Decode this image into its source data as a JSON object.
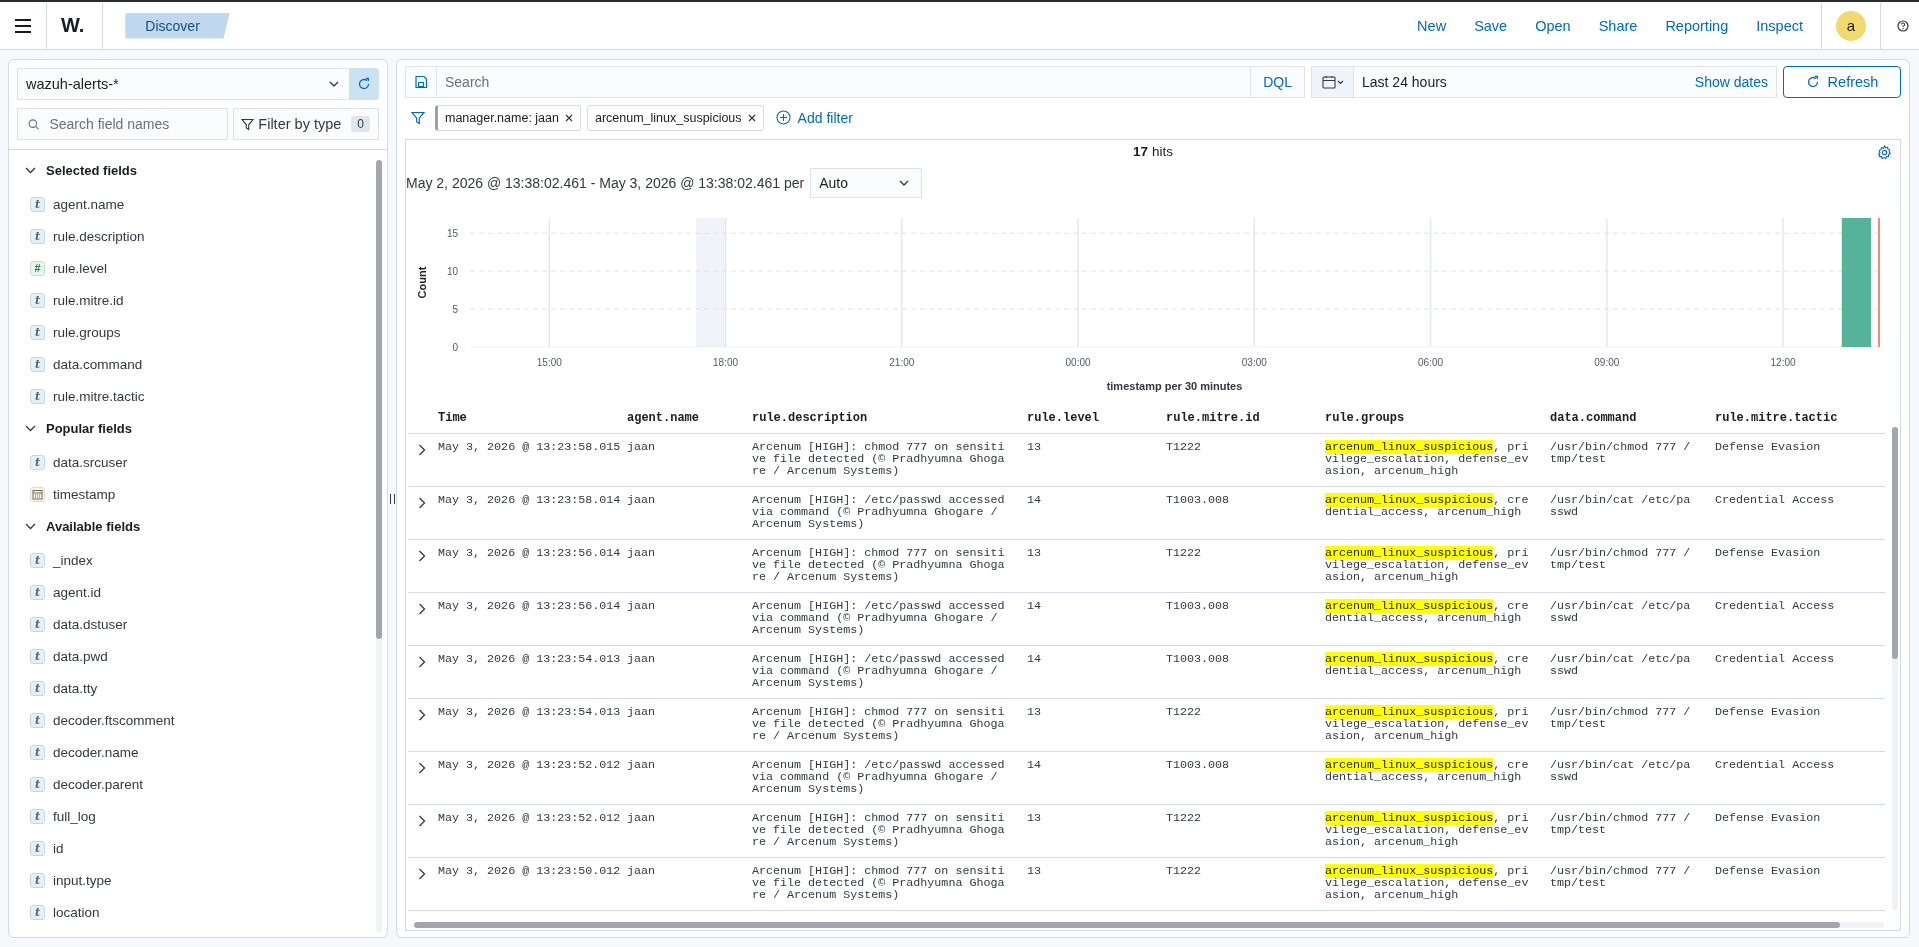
{
  "header": {
    "logo": "W.",
    "breadcrumb": "Discover",
    "actions": [
      "New",
      "Save",
      "Open",
      "Share",
      "Reporting",
      "Inspect"
    ],
    "avatar": "a"
  },
  "sidebar": {
    "index_pattern": "wazuh-alerts-*",
    "search": {
      "placeholder": "Search field names"
    },
    "filter_button": "Filter by type",
    "filter_count": "0",
    "sections": [
      {
        "title": "Selected fields",
        "expanded": true,
        "fields": [
          {
            "name": "agent.name",
            "kind": "string",
            "token": "t"
          },
          {
            "name": "rule.description",
            "kind": "string",
            "token": "t"
          },
          {
            "name": "rule.level",
            "kind": "number",
            "token": "#"
          },
          {
            "name": "rule.mitre.id",
            "kind": "string",
            "token": "t"
          },
          {
            "name": "rule.groups",
            "kind": "string",
            "token": "t"
          },
          {
            "name": "data.command",
            "kind": "string",
            "token": "t"
          },
          {
            "name": "rule.mitre.tactic",
            "kind": "string",
            "token": "t"
          }
        ]
      },
      {
        "title": "Popular fields",
        "expanded": true,
        "fields": [
          {
            "name": "data.srcuser",
            "kind": "string",
            "token": "t"
          },
          {
            "name": "timestamp",
            "kind": "date"
          }
        ]
      },
      {
        "title": "Available fields",
        "expanded": true,
        "fields": [
          {
            "name": "_index",
            "kind": "string",
            "token": "t"
          },
          {
            "name": "agent.id",
            "kind": "string",
            "token": "t"
          },
          {
            "name": "data.dstuser",
            "kind": "string",
            "token": "t"
          },
          {
            "name": "data.pwd",
            "kind": "string",
            "token": "t"
          },
          {
            "name": "data.tty",
            "kind": "string",
            "token": "t"
          },
          {
            "name": "decoder.ftscomment",
            "kind": "string",
            "token": "t"
          },
          {
            "name": "decoder.name",
            "kind": "string",
            "token": "t"
          },
          {
            "name": "decoder.parent",
            "kind": "string",
            "token": "t"
          },
          {
            "name": "full_log",
            "kind": "string",
            "token": "t"
          },
          {
            "name": "id",
            "kind": "string",
            "token": "t"
          },
          {
            "name": "input.type",
            "kind": "string",
            "token": "t"
          },
          {
            "name": "location",
            "kind": "string",
            "token": "t"
          }
        ]
      }
    ]
  },
  "query": {
    "search": {
      "placeholder": "Search"
    },
    "language": "DQL",
    "time_range": "Last 24 hours",
    "show_dates": "Show dates",
    "refresh": "Refresh"
  },
  "filters": [
    {
      "label": "manager.name: jaan"
    },
    {
      "label": "arcenum_linux_suspicious"
    }
  ],
  "add_filter": "Add filter",
  "results": {
    "hits_count": "17",
    "hits_label": "hits",
    "range": "May 2, 2026 @ 13:38:02.461 - May 3, 2026 @ 13:38:02.461 per",
    "interval": "Auto",
    "chart_data": {
      "type": "bar",
      "xlabel": "timestamp per 30 minutes",
      "ylabel": "Count",
      "x": [
        "2026-05-03T13:15:00"
      ],
      "values": [
        17
      ],
      "xlim": [
        "2026-05-02T13:39:00",
        "2026-05-03T13:38:00"
      ],
      "ylim": [
        0,
        17
      ],
      "grid": true,
      "bands": [
        {
          "axis": "x",
          "from": "2026-05-02T17:30:00",
          "to": "2026-05-02T18:00:00"
        }
      ],
      "xticks": [
        {
          "value": "2026-05-02T15:00:00",
          "label": "15:00"
        },
        {
          "value": "2026-05-02T18:00:00",
          "label": "18:00"
        },
        {
          "value": "2026-05-02T21:00:00",
          "label": "21:00"
        },
        {
          "value": "2026-05-03T00:00:00",
          "label": "00:00"
        },
        {
          "value": "2026-05-03T03:00:00",
          "label": "03:00"
        },
        {
          "value": "2026-05-03T06:00:00",
          "label": "06:00"
        },
        {
          "value": "2026-05-03T09:00:00",
          "label": "09:00"
        },
        {
          "value": "2026-05-03T12:00:00",
          "label": "12:00"
        }
      ],
      "yticks": [
        0,
        5,
        10,
        15
      ]
    }
  },
  "table": {
    "columns": [
      "Time",
      "agent.name",
      "rule.description",
      "rule.level",
      "rule.mitre.id",
      "rule.groups",
      "data.command",
      "rule.mitre.tactic"
    ],
    "rows": [
      {
        "expanded": false,
        "time": "May 3, 2026 @ 13:23:58.015",
        "agent": "jaan",
        "description": "Arcenum [HIGH]: chmod 777 on sensitive file detected (© Pradhyumna Ghogare / Arcenum Systems)",
        "level": "13",
        "mitre_id": "T1222",
        "groups_match": "arcenum_linux_suspicious",
        "groups_rest": ", privilege_escalation, defense_evasion, arcenum_high",
        "command": "/usr/bin/chmod 777 /tmp/test",
        "tactic": "Defense Evasion"
      },
      {
        "expanded": false,
        "time": "May 3, 2026 @ 13:23:58.014",
        "agent": "jaan",
        "description": "Arcenum [HIGH]: /etc/passwd accessed via command (© Pradhyumna Ghogare / Arcenum Systems)",
        "level": "14",
        "mitre_id": "T1003.008",
        "groups_match": "arcenum_linux_suspicious",
        "groups_rest": ", credential_access, arcenum_high",
        "command": "/usr/bin/cat /etc/passwd",
        "tactic": "Credential Access"
      },
      {
        "expanded": false,
        "time": "May 3, 2026 @ 13:23:56.014",
        "agent": "jaan",
        "description": "Arcenum [HIGH]: chmod 777 on sensitive file detected (© Pradhyumna Ghogare / Arcenum Systems)",
        "level": "13",
        "mitre_id": "T1222",
        "groups_match": "arcenum_linux_suspicious",
        "groups_rest": ", privilege_escalation, defense_evasion, arcenum_high",
        "command": "/usr/bin/chmod 777 /tmp/test",
        "tactic": "Defense Evasion"
      },
      {
        "expanded": false,
        "time": "May 3, 2026 @ 13:23:56.014",
        "agent": "jaan",
        "description": "Arcenum [HIGH]: /etc/passwd accessed via command (© Pradhyumna Ghogare / Arcenum Systems)",
        "level": "14",
        "mitre_id": "T1003.008",
        "groups_match": "arcenum_linux_suspicious",
        "groups_rest": ", credential_access, arcenum_high",
        "command": "/usr/bin/cat /etc/passwd",
        "tactic": "Credential Access"
      },
      {
        "expanded": false,
        "time": "May 3, 2026 @ 13:23:54.013",
        "agent": "jaan",
        "description": "Arcenum [HIGH]: /etc/passwd accessed via command (© Pradhyumna Ghogare / Arcenum Systems)",
        "level": "14",
        "mitre_id": "T1003.008",
        "groups_match": "arcenum_linux_suspicious",
        "groups_rest": ", credential_access, arcenum_high",
        "command": "/usr/bin/cat /etc/passwd",
        "tactic": "Credential Access"
      },
      {
        "expanded": false,
        "time": "May 3, 2026 @ 13:23:54.013",
        "agent": "jaan",
        "description": "Arcenum [HIGH]: chmod 777 on sensitive file detected (© Pradhyumna Ghogare / Arcenum Systems)",
        "level": "13",
        "mitre_id": "T1222",
        "groups_match": "arcenum_linux_suspicious",
        "groups_rest": ", privilege_escalation, defense_evasion, arcenum_high",
        "command": "/usr/bin/chmod 777 /tmp/test",
        "tactic": "Defense Evasion"
      },
      {
        "expanded": false,
        "time": "May 3, 2026 @ 13:23:52.012",
        "agent": "jaan",
        "description": "Arcenum [HIGH]: /etc/passwd accessed via command (© Pradhyumna Ghogare / Arcenum Systems)",
        "level": "14",
        "mitre_id": "T1003.008",
        "groups_match": "arcenum_linux_suspicious",
        "groups_rest": ", credential_access, arcenum_high",
        "command": "/usr/bin/cat /etc/passwd",
        "tactic": "Credential Access"
      },
      {
        "expanded": false,
        "time": "May 3, 2026 @ 13:23:52.012",
        "agent": "jaan",
        "description": "Arcenum [HIGH]: chmod 777 on sensitive file detected (© Pradhyumna Ghogare / Arcenum Systems)",
        "level": "13",
        "mitre_id": "T1222",
        "groups_match": "arcenum_linux_suspicious",
        "groups_rest": ", privilege_escalation, defense_evasion, arcenum_high",
        "command": "/usr/bin/chmod 777 /tmp/test",
        "tactic": "Defense Evasion"
      },
      {
        "expanded": false,
        "time": "May 3, 2026 @ 13:23:50.012",
        "agent": "jaan",
        "description": "Arcenum [HIGH]: chmod 777 on sensitive file detected (© Pradhyumna Ghogare / Arcenum Systems)",
        "level": "13",
        "mitre_id": "T1222",
        "groups_match": "arcenum_linux_suspicious",
        "groups_rest": ", privilege_escalation, defense_evasion, arcenum_high",
        "command": "/usr/bin/chmod 777 /tmp/test",
        "tactic": "Defense Evasion"
      }
    ]
  }
}
